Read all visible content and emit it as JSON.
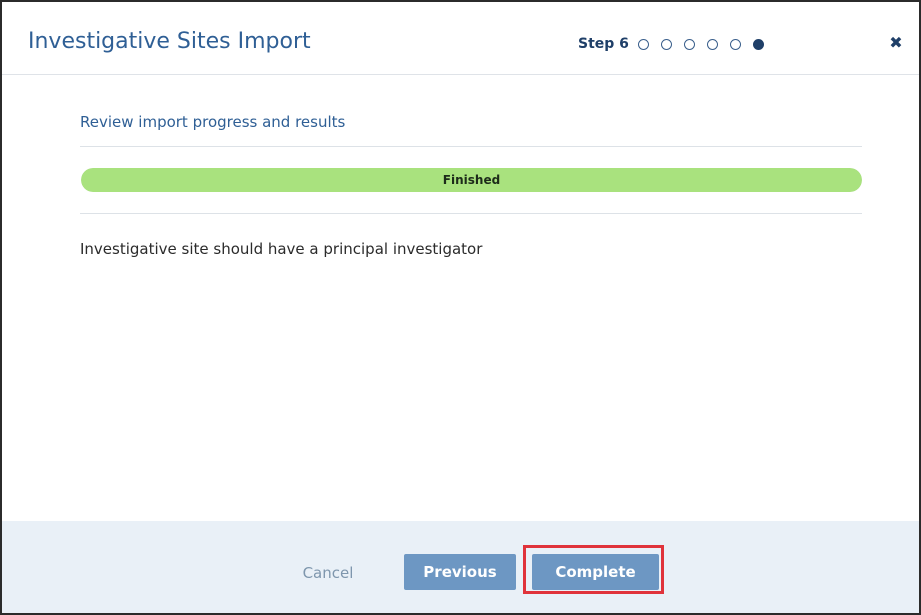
{
  "dialog": {
    "title": "Investigative Sites Import",
    "step_label": "Step 6",
    "step_total": 6,
    "step_current": 6,
    "close_icon": "close-icon"
  },
  "content": {
    "section_title": "Review import progress and results",
    "progress": {
      "label": "Finished",
      "fraction": 1.0,
      "color": "#a9e27e"
    },
    "message": "Investigative site should have a principal investigator"
  },
  "footer": {
    "cancel_label": "Cancel",
    "previous_label": "Previous",
    "complete_label": "Complete",
    "highlight_color": "#e0333b"
  }
}
